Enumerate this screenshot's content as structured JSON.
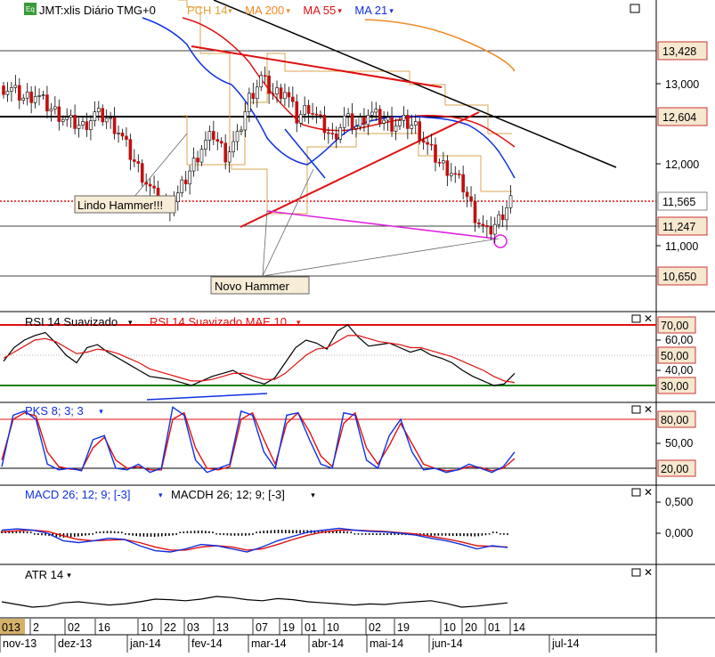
{
  "chart_data": {
    "type": "candlestick",
    "symbol_label": "JMT:xlis Diário TMG+0",
    "price_pane": {
      "legend": [
        {
          "id": "pch",
          "text": "PCH 14",
          "color": "#e3a23a"
        },
        {
          "id": "ma200",
          "text": "MA 200",
          "color": "#f08a24"
        },
        {
          "id": "ma55",
          "text": "MA 55",
          "color": "#e01010"
        },
        {
          "id": "ma21",
          "text": "MA 21",
          "color": "#1030e0"
        }
      ],
      "yticks": [
        "13,000",
        "12,000",
        "11,000"
      ],
      "price_tags": [
        {
          "value": "13,428"
        },
        {
          "value": "12,604"
        },
        {
          "value": "11,565",
          "current": true
        },
        {
          "value": "11,247"
        },
        {
          "value": "10,650"
        }
      ],
      "annotations": [
        "Lindo Hammer!!!",
        "Novo Hammer"
      ],
      "ohlc_close_trace": [
        12.95,
        12.9,
        12.8,
        12.85,
        12.7,
        12.6,
        12.5,
        12.45,
        12.6,
        12.55,
        12.4,
        12.1,
        11.85,
        11.6,
        11.45,
        11.6,
        11.9,
        12.2,
        12.35,
        12.1,
        12.3,
        12.8,
        13.05,
        12.85,
        12.9,
        12.55,
        12.7,
        12.5,
        12.3,
        12.55,
        12.45,
        12.62,
        12.55,
        12.48,
        12.5,
        12.45,
        12.2,
        12.0,
        11.9,
        11.7,
        11.35,
        11.12,
        11.3,
        11.565
      ]
    },
    "rsi_pane": {
      "legend": [
        {
          "id": "rsi",
          "text": "RSI 14 Suavizado",
          "color": "#000000"
        },
        {
          "id": "rsimae",
          "text": "RSI 14 Suavizado MAE 10",
          "color": "#e01010"
        }
      ],
      "yticks": [
        "60,00",
        "40,00"
      ],
      "levels": [
        {
          "value": "70,00"
        },
        {
          "value": "50,00"
        },
        {
          "value": "30,00"
        }
      ],
      "rsi": [
        46,
        55,
        60,
        63,
        65,
        58,
        50,
        45,
        55,
        57,
        52,
        48,
        44,
        40,
        36,
        35,
        34,
        32,
        30,
        33,
        36,
        38,
        40,
        36,
        33,
        31,
        35,
        45,
        55,
        60,
        58,
        54,
        66,
        70,
        62,
        56,
        57,
        58,
        55,
        52,
        54,
        50,
        48,
        45,
        40,
        36,
        33,
        30,
        31,
        38
      ],
      "rsi_mae": [
        48,
        52,
        56,
        60,
        61,
        59,
        55,
        51,
        52,
        54,
        53,
        51,
        48,
        45,
        41,
        39,
        37,
        35,
        33,
        33,
        34,
        36,
        38,
        38,
        36,
        34,
        34,
        38,
        44,
        50,
        54,
        55,
        59,
        63,
        63,
        61,
        59,
        58,
        57,
        55,
        55,
        53,
        51,
        49,
        46,
        43,
        40,
        36,
        33,
        32
      ]
    },
    "stoch_pane": {
      "legend": [
        {
          "id": "pks",
          "text": "PKS 8; 3; 3",
          "color": "#1030e0"
        }
      ],
      "yticks": [
        "50,00"
      ],
      "levels": [
        {
          "value": "80,00"
        },
        {
          "value": "20,00"
        }
      ],
      "k": [
        22,
        85,
        90,
        80,
        25,
        18,
        20,
        17,
        55,
        60,
        20,
        18,
        25,
        15,
        20,
        95,
        85,
        30,
        15,
        20,
        25,
        90,
        85,
        40,
        20,
        85,
        88,
        55,
        25,
        20,
        88,
        85,
        30,
        20,
        60,
        80,
        40,
        18,
        20,
        15,
        18,
        25,
        20,
        15,
        22,
        40
      ],
      "d": [
        30,
        80,
        88,
        84,
        40,
        22,
        19,
        18,
        45,
        58,
        30,
        20,
        22,
        18,
        18,
        80,
        88,
        45,
        20,
        18,
        22,
        80,
        88,
        55,
        25,
        75,
        88,
        65,
        35,
        22,
        75,
        88,
        45,
        25,
        48,
        75,
        50,
        25,
        20,
        17,
        18,
        22,
        21,
        17,
        20,
        32
      ]
    },
    "macd_pane": {
      "legend": [
        {
          "id": "macd",
          "text": "MACD 26; 12; 9; [-3]",
          "color": "#1030e0"
        },
        {
          "id": "macdh",
          "text": "MACDH 26; 12; 9; [-3]",
          "color": "#000000"
        }
      ],
      "yticks": [
        "0,500",
        "0,000"
      ],
      "macd": [
        0.05,
        0.07,
        0.05,
        0.0,
        -0.12,
        -0.15,
        -0.12,
        -0.08,
        -0.1,
        -0.2,
        -0.28,
        -0.3,
        -0.25,
        -0.18,
        -0.2,
        -0.25,
        -0.3,
        -0.22,
        -0.12,
        -0.05,
        0.02,
        0.05,
        0.08,
        0.05,
        0.03,
        0.02,
        0.0,
        -0.03,
        -0.08,
        -0.12,
        -0.18,
        -0.25,
        -0.2,
        -0.23
      ],
      "signal": [
        0.02,
        0.04,
        0.05,
        0.03,
        -0.04,
        -0.1,
        -0.12,
        -0.11,
        -0.1,
        -0.15,
        -0.22,
        -0.27,
        -0.27,
        -0.22,
        -0.2,
        -0.22,
        -0.27,
        -0.25,
        -0.18,
        -0.1,
        -0.03,
        0.02,
        0.05,
        0.05,
        0.04,
        0.03,
        0.01,
        -0.01,
        -0.05,
        -0.09,
        -0.14,
        -0.2,
        -0.21,
        -0.22
      ]
    },
    "atr_pane": {
      "legend": [
        {
          "id": "atr",
          "text": "ATR 14",
          "color": "#000000"
        }
      ],
      "atr": [
        0.4,
        0.35,
        0.3,
        0.32,
        0.38,
        0.4,
        0.37,
        0.34,
        0.36,
        0.4,
        0.45,
        0.44,
        0.42,
        0.45,
        0.5,
        0.48,
        0.44,
        0.42,
        0.46,
        0.44,
        0.4,
        0.38,
        0.36,
        0.34,
        0.36,
        0.35,
        0.38,
        0.4,
        0.42,
        0.37,
        0.3,
        0.32,
        0.35,
        0.38
      ]
    },
    "time_axis": {
      "days": [
        "013",
        "2",
        "02",
        "16",
        "10",
        "22",
        "03",
        "13",
        "07",
        "19",
        "01",
        "10",
        "02",
        "19",
        "10",
        "20",
        "01",
        "14"
      ],
      "months": [
        "nov-13",
        "dez-13",
        "jan-14",
        "fev-14",
        "mar-14",
        "abr-14",
        "mai-14",
        "jun-14",
        "jul-14"
      ]
    }
  }
}
